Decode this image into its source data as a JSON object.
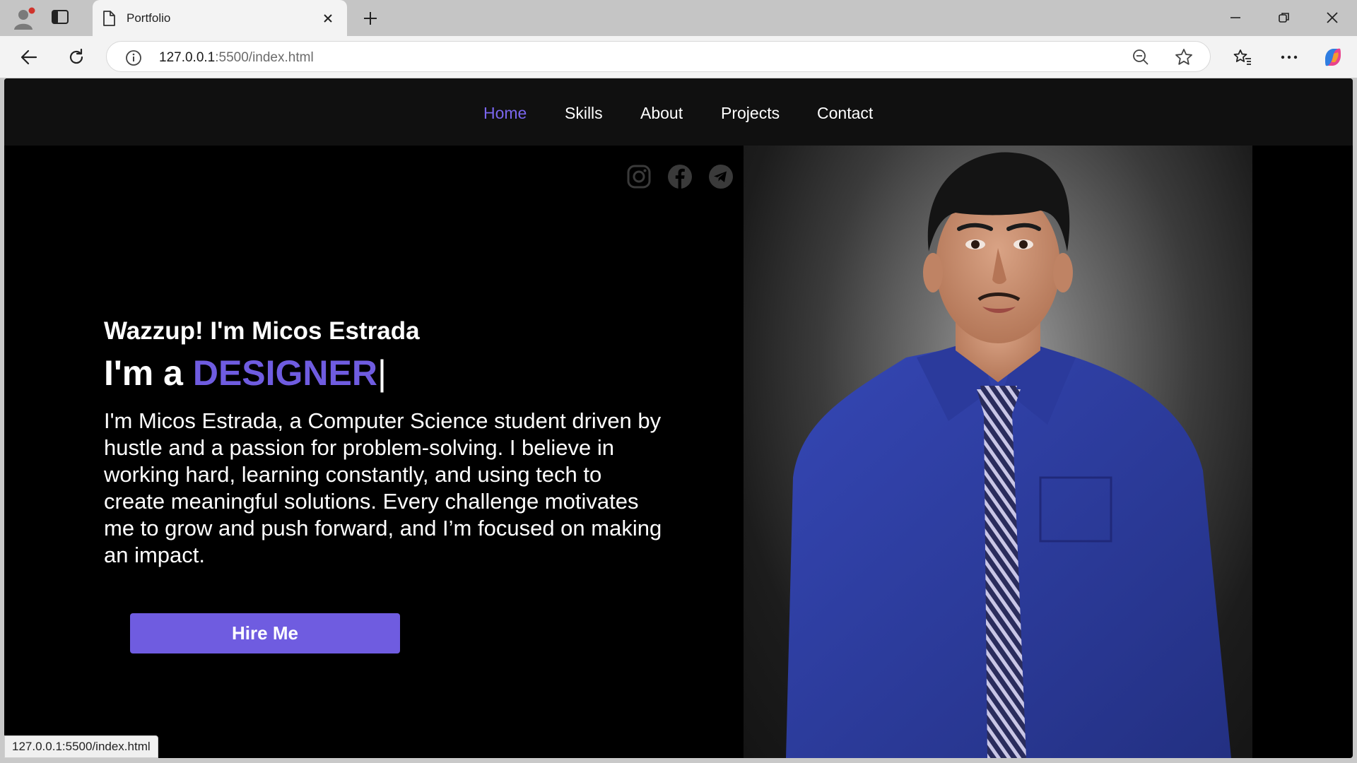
{
  "browser": {
    "tab_title": "Portfolio",
    "url_host": "127.0.0.1",
    "url_rest": ":5500/index.html",
    "status_url": "127.0.0.1:5500/index.html"
  },
  "nav": {
    "items": [
      "Home",
      "Skills",
      "About",
      "Projects",
      "Contact"
    ],
    "active": "Home"
  },
  "hero": {
    "greeting": "Wazzup! I'm Micos Estrada",
    "role_prefix": "I'm a ",
    "role_highlight": "DESIGNER",
    "role_cursor": "|",
    "bio": "I'm Micos Estrada, a Computer Science student driven by hustle and a passion for problem-solving. I believe in working hard, learning constantly, and using tech to create meaningful solutions. Every challenge motivates me to grow and push forward, and I’m focused on making an impact.",
    "cta": "Hire Me"
  },
  "socials": [
    "instagram-icon",
    "facebook-icon",
    "telegram-icon"
  ],
  "colors": {
    "accent": "#6f5ce0",
    "nav_active": "#7a66ee",
    "page_bg": "#000000",
    "nav_bg": "#101010",
    "social_icon": "#3a3a3a",
    "shirt": "#2f3ea0"
  }
}
